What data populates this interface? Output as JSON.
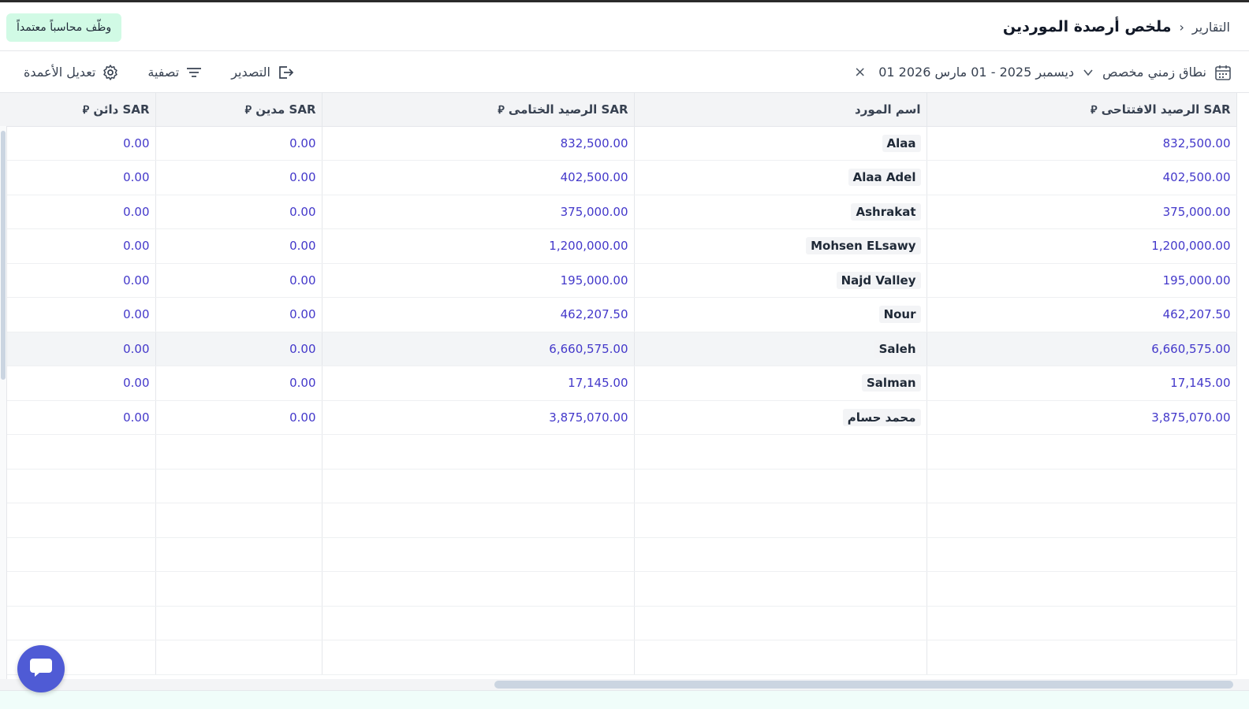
{
  "header": {
    "breadcrumb_parent": "التقارير",
    "breadcrumb_separator": "›",
    "page_title": "ملخص أرصدة الموردين",
    "hire_button": "وظّف محاسباً معتمداً"
  },
  "toolbar": {
    "range_label": "نطاق زمني مخصص",
    "date_range": "01 ديسمبر 2025 - 01 مارس 2026",
    "clear": "×",
    "edit_columns": "تعديل الأعمدة",
    "filter": "تصفية",
    "export": "التصدير"
  },
  "table": {
    "currency_symbol": "⃁",
    "headers": {
      "opening": "الرصيد الافتتاحى SAR",
      "supplier": "اسم المورد",
      "closing": "الرصيد الختامى SAR",
      "debit": "مدين SAR",
      "credit": "دائن SAR"
    },
    "rows": [
      {
        "opening": "832,500.00",
        "supplier": "Alaa",
        "closing": "832,500.00",
        "debit": "0.00",
        "credit": "0.00"
      },
      {
        "opening": "402,500.00",
        "supplier": "Alaa Adel",
        "closing": "402,500.00",
        "debit": "0.00",
        "credit": "0.00"
      },
      {
        "opening": "375,000.00",
        "supplier": "Ashrakat",
        "closing": "375,000.00",
        "debit": "0.00",
        "credit": "0.00"
      },
      {
        "opening": "1,200,000.00",
        "supplier": "Mohsen ELsawy",
        "closing": "1,200,000.00",
        "debit": "0.00",
        "credit": "0.00"
      },
      {
        "opening": "195,000.00",
        "supplier": "Najd Valley",
        "closing": "195,000.00",
        "debit": "0.00",
        "credit": "0.00"
      },
      {
        "opening": "462,207.50",
        "supplier": "Nour",
        "closing": "462,207.50",
        "debit": "0.00",
        "credit": "0.00"
      },
      {
        "opening": "6,660,575.00",
        "supplier": "Saleh",
        "closing": "6,660,575.00",
        "debit": "0.00",
        "credit": "0.00"
      },
      {
        "opening": "17,145.00",
        "supplier": "Salman",
        "closing": "17,145.00",
        "debit": "0.00",
        "credit": "0.00"
      },
      {
        "opening": "3,875,070.00",
        "supplier": "محمد حسام",
        "closing": "3,875,070.00",
        "debit": "0.00",
        "credit": "0.00"
      }
    ]
  },
  "colors": {
    "accent_number": "#4338ca",
    "hire_bg": "#d1fae5",
    "chat_bg": "#4f5bd5"
  },
  "icons": [
    "calendar-icon",
    "chevron-down-icon",
    "close-icon",
    "gear-icon",
    "filter-icon",
    "export-icon",
    "chat-icon"
  ]
}
